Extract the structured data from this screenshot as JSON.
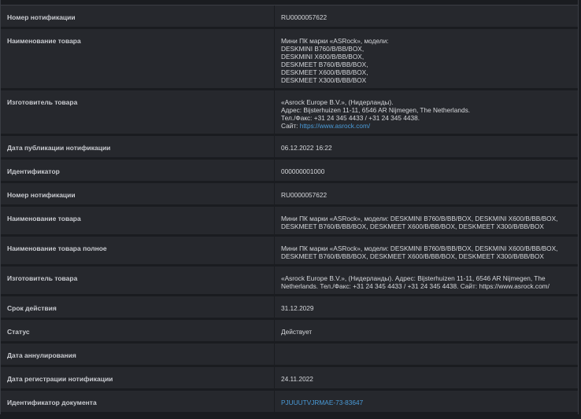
{
  "rows": [
    {
      "label": "Номер нотификации",
      "value": "RU0000057622"
    },
    {
      "label": "Наименование товара",
      "value": "Мини ПК марки «ASRock», модели:\nDESKMINI B760/B/BB/BOX,\nDESKMINI X600/B/BB/BOX,\nDESKMEET B760/B/BB/BOX,\nDESKMEET X600/B/BB/BOX,\nDESKMEET X300/B/BB/BOX"
    },
    {
      "label": "Изготовитель товара",
      "value": "«Asrock Europe B.V.», (Нидерланды).\nАдрес: Bijsterhuizen 11-11, 6546 AR Nijmegen, The Netherlands.\nТел./Факс: +31 24 345 4433 / +31 24 345 4438.",
      "site_label": "Сайт: ",
      "site_link": "https://www.asrock.com/"
    },
    {
      "label": "Дата публикации нотификации",
      "value": "06.12.2022 16:22"
    },
    {
      "label": "Идентификатор",
      "value": "000000001000"
    },
    {
      "label": "Номер нотификации",
      "value": "RU0000057622"
    },
    {
      "label": "Наименование товара",
      "value": "Мини ПК марки «ASRock», модели: DESKMINI B760/B/BB/BOX, DESKMINI X600/B/BB/BOX,\nDESKMEET B760/B/BB/BOX, DESKMEET X600/B/BB/BOX, DESKMEET X300/B/BB/BOX"
    },
    {
      "label": "Наименование товара полное",
      "value": "Мини ПК марки «ASRock», модели: DESKMINI B760/B/BB/BOX, DESKMINI X600/B/BB/BOX,\nDESKMEET B760/B/BB/BOX, DESKMEET X600/B/BB/BOX, DESKMEET X300/B/BB/BOX"
    },
    {
      "label": "Изготовитель товара",
      "value": "«Asrock Europe B.V.», (Нидерланды). Адрес: Bijsterhuizen 11-11, 6546 AR Nijmegen, The\nNetherlands. Тел./Факс: +31 24 345 4433 / +31 24 345 4438. Сайт: https://www.asrock.com/"
    },
    {
      "label": "Срок действия",
      "value": "31.12.2029"
    },
    {
      "label": "Статус",
      "value": "Действует"
    },
    {
      "label": "Дата аннулирования",
      "value": ""
    },
    {
      "label": "Дата регистрации нотификации",
      "value": "24.11.2022"
    },
    {
      "label": "Идентификатор документа",
      "value": "",
      "link": "PJUUUTVJRMAE-73-83647"
    }
  ]
}
